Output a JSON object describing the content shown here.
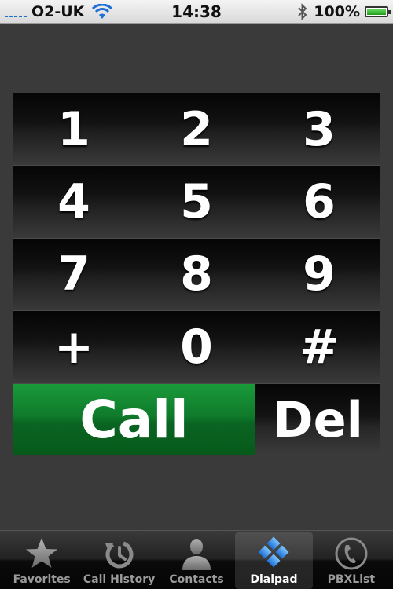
{
  "status_bar": {
    "carrier": "O2-UK",
    "time": "14:38",
    "battery_percent": "100%",
    "battery_level": 1.0,
    "signal_bars": 5
  },
  "dialpad": {
    "keys": [
      "1",
      "2",
      "3",
      "4",
      "5",
      "6",
      "7",
      "8",
      "9",
      "+",
      "0",
      "#"
    ],
    "call_label": "Call",
    "delete_label": "Del"
  },
  "tab_bar": {
    "tabs": [
      {
        "label": "Favorites",
        "icon": "star-icon"
      },
      {
        "label": "Call History",
        "icon": "history-icon"
      },
      {
        "label": "Contacts",
        "icon": "person-icon"
      },
      {
        "label": "Dialpad",
        "icon": "keypad-icon"
      },
      {
        "label": "PBXList",
        "icon": "phone-icon"
      }
    ],
    "active_index": 3
  },
  "colors": {
    "call_green": "#0f7a2b",
    "background": "#3a3a3a",
    "signal_blue": "#1f6fd8",
    "active_tab_blue": "#2d8bf0"
  }
}
